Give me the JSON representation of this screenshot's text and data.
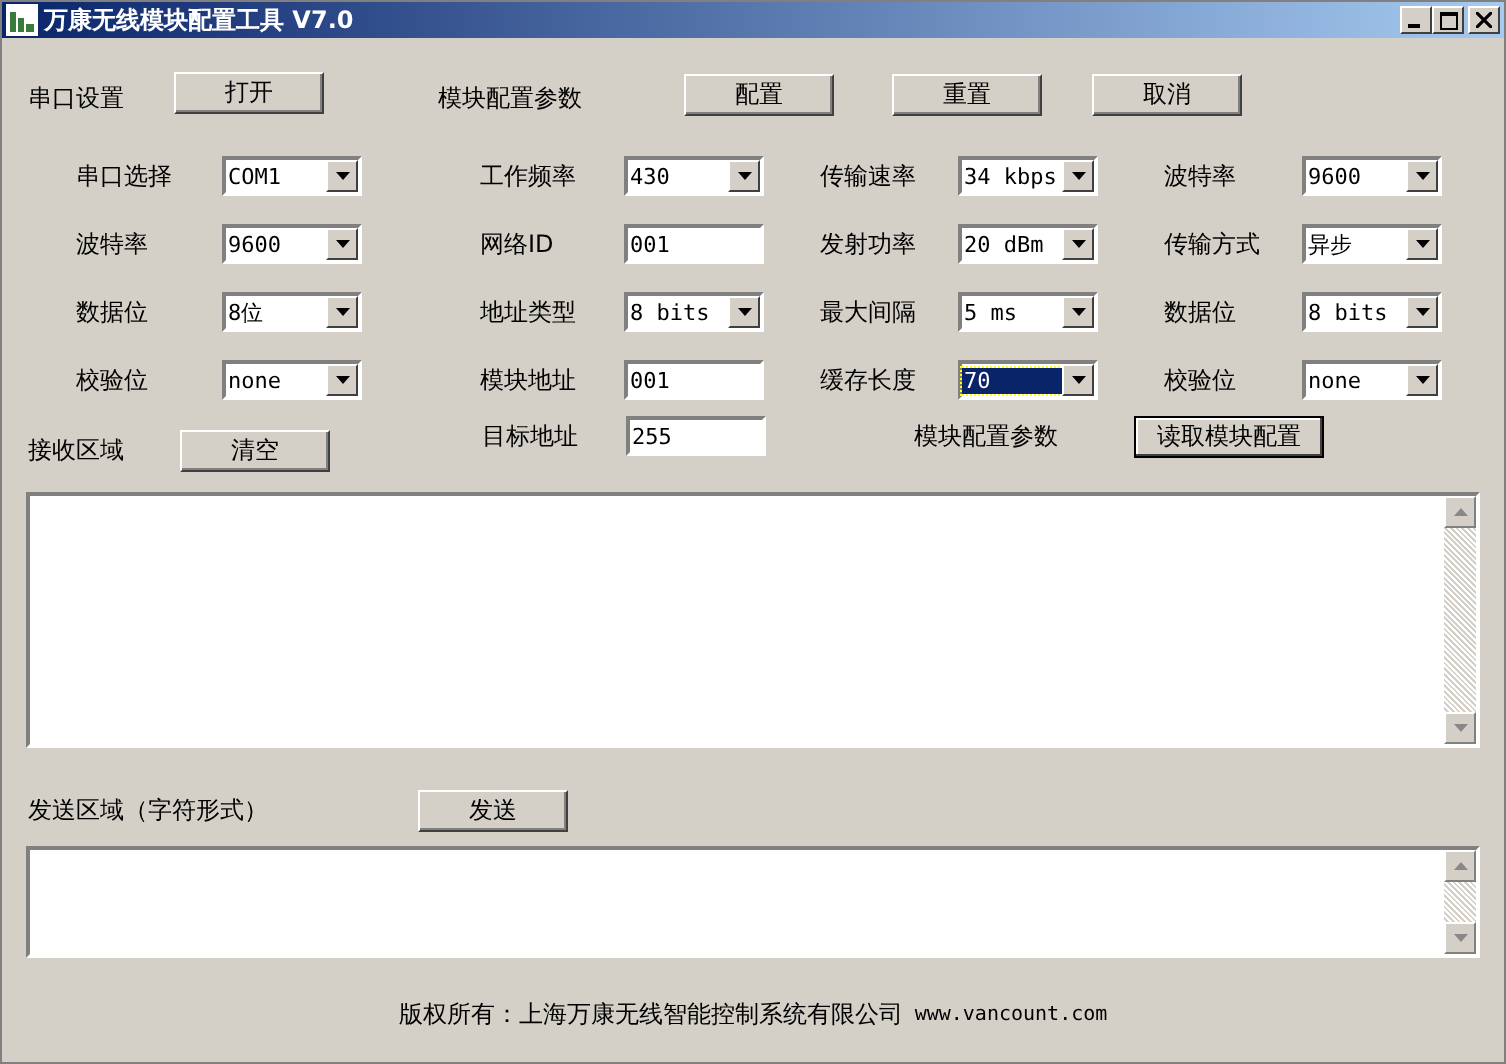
{
  "window": {
    "title": "万康无线模块配置工具 V7.0"
  },
  "header": {
    "serial_label": "串口设置",
    "open_button": "打开",
    "module_label": "模块配置参数",
    "buttons": [
      "配置",
      "重置",
      "取消"
    ]
  },
  "fields": [
    {
      "label": "串口选择",
      "kind": "combo",
      "value": "COM1",
      "focused": false
    },
    {
      "label": "工作频率",
      "kind": "combo",
      "value": "430",
      "focused": false
    },
    {
      "label": "传输速率",
      "kind": "combo",
      "value": "34 kbps",
      "focused": false
    },
    {
      "label": "波特率",
      "kind": "combo",
      "value": "9600",
      "focused": false
    },
    {
      "label": "波特率",
      "kind": "combo",
      "value": "9600",
      "focused": false
    },
    {
      "label": "网络ID",
      "kind": "input",
      "value": "001",
      "focused": false
    },
    {
      "label": "发射功率",
      "kind": "combo",
      "value": "20 dBm",
      "focused": false
    },
    {
      "label": "传输方式",
      "kind": "combo",
      "value": "异步",
      "focused": false
    },
    {
      "label": "数据位",
      "kind": "combo",
      "value": "8位",
      "focused": false
    },
    {
      "label": "地址类型",
      "kind": "combo",
      "value": "8 bits",
      "focused": false
    },
    {
      "label": "最大间隔",
      "kind": "combo",
      "value": "5 ms",
      "focused": false
    },
    {
      "label": "数据位",
      "kind": "combo",
      "value": "8 bits",
      "focused": false
    },
    {
      "label": "校验位",
      "kind": "combo",
      "value": "none",
      "focused": false
    },
    {
      "label": "模块地址",
      "kind": "input",
      "value": "001",
      "focused": false
    },
    {
      "label": "缓存长度",
      "kind": "combo",
      "value": "70",
      "focused": true
    },
    {
      "label": "校验位",
      "kind": "combo",
      "value": "none",
      "focused": false
    }
  ],
  "target_address": {
    "label": "目标地址",
    "value": "255"
  },
  "receive": {
    "label": "接收区域",
    "clear_button": "清空",
    "module_label": "模块配置参数",
    "read_button": "读取模块配置"
  },
  "send": {
    "label": "发送区域（字符形式）",
    "send_button": "发送"
  },
  "footer": {
    "copyright": "版权所有：上海万康无线智能控制系统有限公司",
    "website": "www.vancount.com"
  }
}
